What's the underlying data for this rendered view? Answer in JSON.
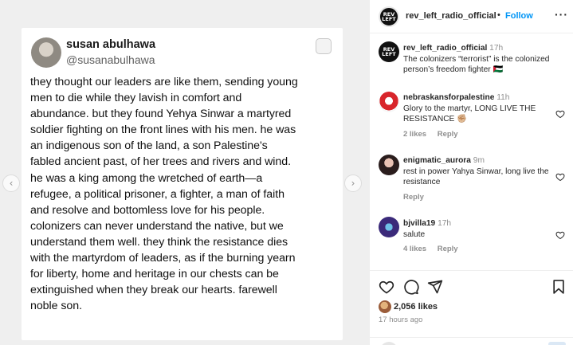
{
  "tweet": {
    "name": "susan abulhawa",
    "handle": "@susanabulhawa",
    "body": "they thought our leaders are like them, sending young\nmen to die while they lavish in comfort and\nabundance. but they found Yehya Sinwar a martyred\nsoldier fighting on the front lines with his men. he was\nan indigenous son of the land, a son Palestine's\nfabled ancient past, of her trees and rivers and wind.\nhe was a king among the wretched of earth—a\nrefugee, a political prisoner, a fighter, a man of faith\nand resolve and bottomless love for his people.\ncolonizers can never understand the native, but we\nunderstand them well. they think the resistance dies\nwith the martyrdom of leaders, as if the burning yearn\nfor liberty, home and heritage in our chests can be\nextinguished when they break our hearts. farewell\nnoble son."
  },
  "media": {
    "prev_icon": "chevron-left-icon",
    "next_icon": "chevron-right-icon"
  },
  "header": {
    "username": "rev_left_radio_official",
    "separator": "•",
    "follow_label": "Follow",
    "more_label": "···",
    "avatar_text": "REV LEFT"
  },
  "caption": {
    "username": "rev_left_radio_official",
    "time": "17h",
    "text": "The colonizers “terrorist” is the colonized person’s freedom fighter 🇵🇸"
  },
  "comments": [
    {
      "username": "nebraskansforpalestine",
      "time": "11h",
      "text": "Glory to the martyr, LONG LIVE THE RESISTANCE ✊🏼",
      "likes": "2 likes",
      "reply": "Reply"
    },
    {
      "username": "enigmatic_aurora",
      "time": "9m",
      "text": "rest in power Yahya Sinwar, long live the resistance",
      "likes": "",
      "reply": "Reply"
    },
    {
      "username": "bjvilla19",
      "time": "17h",
      "text": "salute",
      "likes": "4 likes",
      "reply": "Reply"
    }
  ],
  "actions": {
    "likes": "2,056 likes",
    "posted": "17 hours ago"
  },
  "colors": {
    "link_blue": "#0095f6",
    "muted": "#8e8e8e"
  }
}
